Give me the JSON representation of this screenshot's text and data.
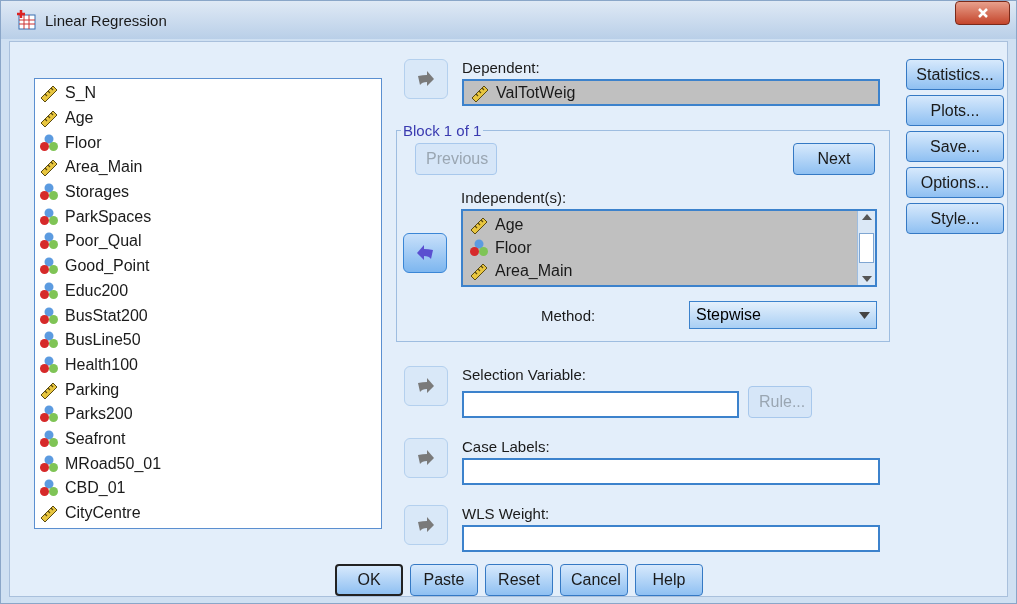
{
  "window": {
    "title": "Linear Regression"
  },
  "variables": [
    {
      "name": "S_N",
      "kind": "scale"
    },
    {
      "name": "Age",
      "kind": "scale"
    },
    {
      "name": "Floor",
      "kind": "nominal"
    },
    {
      "name": "Area_Main",
      "kind": "scale"
    },
    {
      "name": "Storages",
      "kind": "nominal"
    },
    {
      "name": "ParkSpaces",
      "kind": "nominal"
    },
    {
      "name": "Poor_Qual",
      "kind": "nominal"
    },
    {
      "name": "Good_Point",
      "kind": "nominal"
    },
    {
      "name": "Educ200",
      "kind": "nominal"
    },
    {
      "name": "BusStat200",
      "kind": "nominal"
    },
    {
      "name": "BusLine50",
      "kind": "nominal"
    },
    {
      "name": "Health100",
      "kind": "nominal"
    },
    {
      "name": "Parking",
      "kind": "scale"
    },
    {
      "name": "Parks200",
      "kind": "nominal"
    },
    {
      "name": "Seafront",
      "kind": "nominal"
    },
    {
      "name": "MRoad50_01",
      "kind": "nominal"
    },
    {
      "name": "CBD_01",
      "kind": "nominal"
    },
    {
      "name": "CityCentre",
      "kind": "scale"
    }
  ],
  "dependent": {
    "label": "Dependent:",
    "arrow": {
      "kind": "add",
      "disabled": true
    },
    "value": {
      "name": "ValTotWeig",
      "kind": "scale"
    }
  },
  "block": {
    "title": "Block 1 of 1",
    "previous": {
      "label": "Previous",
      "disabled": true
    },
    "next": {
      "label": "Next",
      "disabled": false
    },
    "independent": {
      "label": "Independent(s):",
      "arrow": {
        "kind": "remove",
        "disabled": false
      },
      "items": [
        {
          "name": "Age",
          "kind": "scale"
        },
        {
          "name": "Floor",
          "kind": "nominal"
        },
        {
          "name": "Area_Main",
          "kind": "scale"
        }
      ]
    },
    "method": {
      "label": "Method:",
      "value": "Stepwise"
    }
  },
  "selection_variable": {
    "label": "Selection Variable:",
    "arrow": {
      "kind": "add",
      "disabled": true
    },
    "rule": {
      "label": "Rule...",
      "disabled": true
    }
  },
  "case_labels": {
    "label": "Case Labels:",
    "arrow": {
      "kind": "add",
      "disabled": true
    }
  },
  "wls_weight": {
    "label": "WLS Weight:",
    "arrow": {
      "kind": "add",
      "disabled": true
    }
  },
  "side_buttons": [
    "Statistics...",
    "Plots...",
    "Save...",
    "Options...",
    "Style..."
  ],
  "buttons": [
    {
      "label": "OK",
      "default": true
    },
    {
      "label": "Paste",
      "default": false
    },
    {
      "label": "Reset",
      "default": false
    },
    {
      "label": "Cancel",
      "default": false
    },
    {
      "label": "Help",
      "default": false
    }
  ]
}
